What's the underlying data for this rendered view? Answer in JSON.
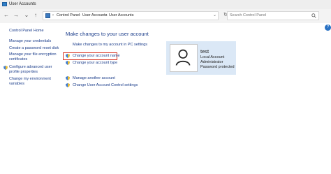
{
  "window": {
    "title": "User Accounts"
  },
  "address": {
    "crumbs": [
      "Control Panel",
      "User Accounts",
      "User Accounts"
    ]
  },
  "search": {
    "placeholder": "Search Control Panel"
  },
  "sidebar": {
    "home": "Control Panel Home",
    "items": [
      {
        "label": "Manage your credentials"
      },
      {
        "label": "Create a password reset disk"
      },
      {
        "label": "Manage your file encryption certificates"
      },
      {
        "label": "Configure advanced user profile properties"
      },
      {
        "label": "Change my environment variables"
      }
    ]
  },
  "main": {
    "heading": "Make changes to your user account",
    "pc_settings_link": "Make changes to my account in PC settings",
    "links": [
      {
        "label": "Change your account name"
      },
      {
        "label": "Change your account type"
      }
    ],
    "more_links": [
      {
        "label": "Manage another account"
      },
      {
        "label": "Change User Account Control settings"
      }
    ]
  },
  "user": {
    "name": "test",
    "lines": [
      "Local Account",
      "Administrator",
      "Password protected"
    ]
  },
  "colors": {
    "accent": "#1a3c8a",
    "highlight": "#d9301f",
    "panel": "#dbe8f6"
  }
}
